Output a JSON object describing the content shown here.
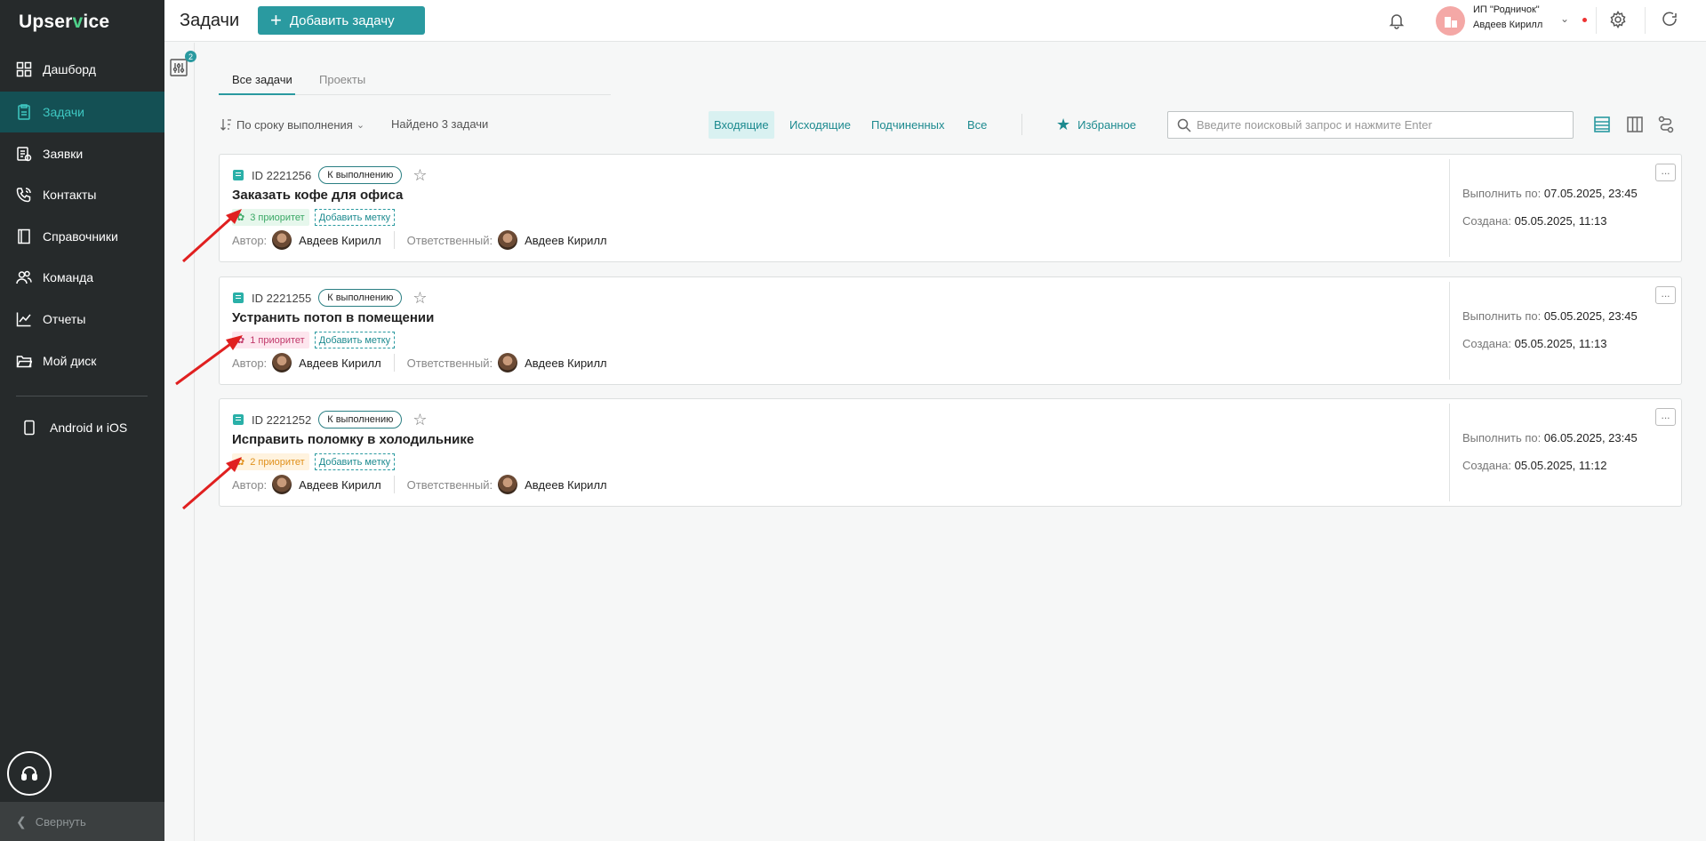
{
  "app": {
    "logo_main": "Upser",
    "logo_v": "v",
    "logo_end": "ice"
  },
  "sidebar": {
    "items": [
      {
        "label": "Дашборд",
        "icon": "dashboard-icon"
      },
      {
        "label": "Задачи",
        "icon": "tasks-icon"
      },
      {
        "label": "Заявки",
        "icon": "requests-icon"
      },
      {
        "label": "Контакты",
        "icon": "contacts-icon"
      },
      {
        "label": "Справочники",
        "icon": "book-icon"
      },
      {
        "label": "Команда",
        "icon": "team-icon"
      },
      {
        "label": "Отчеты",
        "icon": "chart-icon"
      },
      {
        "label": "Мой диск",
        "icon": "folder-icon"
      }
    ],
    "mobile": "Android и iOS",
    "collapse": "Свернуть"
  },
  "filter_badge": "2",
  "header": {
    "title": "Задачи",
    "add_button": "Добавить задачу",
    "org_name": "ИП \"Родничок\"",
    "user_name": "Авдеев Кирилл"
  },
  "tabs": [
    "Все задачи",
    "Проекты"
  ],
  "toolbar": {
    "sort": "По сроку выполнения",
    "found": "Найдено 3 задачи",
    "scopes": [
      "Входящие",
      "Исходящие",
      "Подчиненных",
      "Все"
    ],
    "favorites": "Избранное",
    "search_placeholder": "Введите поисковый запрос и нажмите Enter"
  },
  "labels": {
    "author": "Автор:",
    "responsible": "Ответственный:",
    "due": "Выполнить по:",
    "created": "Создана:",
    "add_label": "Добавить метку"
  },
  "tasks": [
    {
      "id": "ID 2221256",
      "status": "К выполнению",
      "title": "Заказать кофе для офиса",
      "priority": "3 приоритет",
      "author": "Авдеев Кирилл",
      "responsible": "Авдеев Кирилл",
      "due": "07.05.2025, 23:45",
      "created": "05.05.2025, 11:13"
    },
    {
      "id": "ID 2221255",
      "status": "К выполнению",
      "title": "Устранить потоп в помещении",
      "priority": "1 приоритет",
      "author": "Авдеев Кирилл",
      "responsible": "Авдеев Кирилл",
      "due": "05.05.2025, 23:45",
      "created": "05.05.2025, 11:13"
    },
    {
      "id": "ID 2221252",
      "status": "К выполнению",
      "title": "Исправить поломку в холодильнике",
      "priority": "2 приоритет",
      "author": "Авдеев Кирилл",
      "responsible": "Авдеев Кирилл",
      "due": "06.05.2025, 23:45",
      "created": "05.05.2025, 11:12"
    }
  ],
  "colors": {
    "accent": "#2a9aa0",
    "sidebar_bg": "#262a2b",
    "prio_3_bg": "#e6f7ec",
    "prio_3_fg": "#3aa865",
    "prio_1_bg": "#fde6ee",
    "prio_1_fg": "#c0386a",
    "prio_2_bg": "#fff3df",
    "prio_2_fg": "#e0901b",
    "arrow": "#e02020"
  }
}
